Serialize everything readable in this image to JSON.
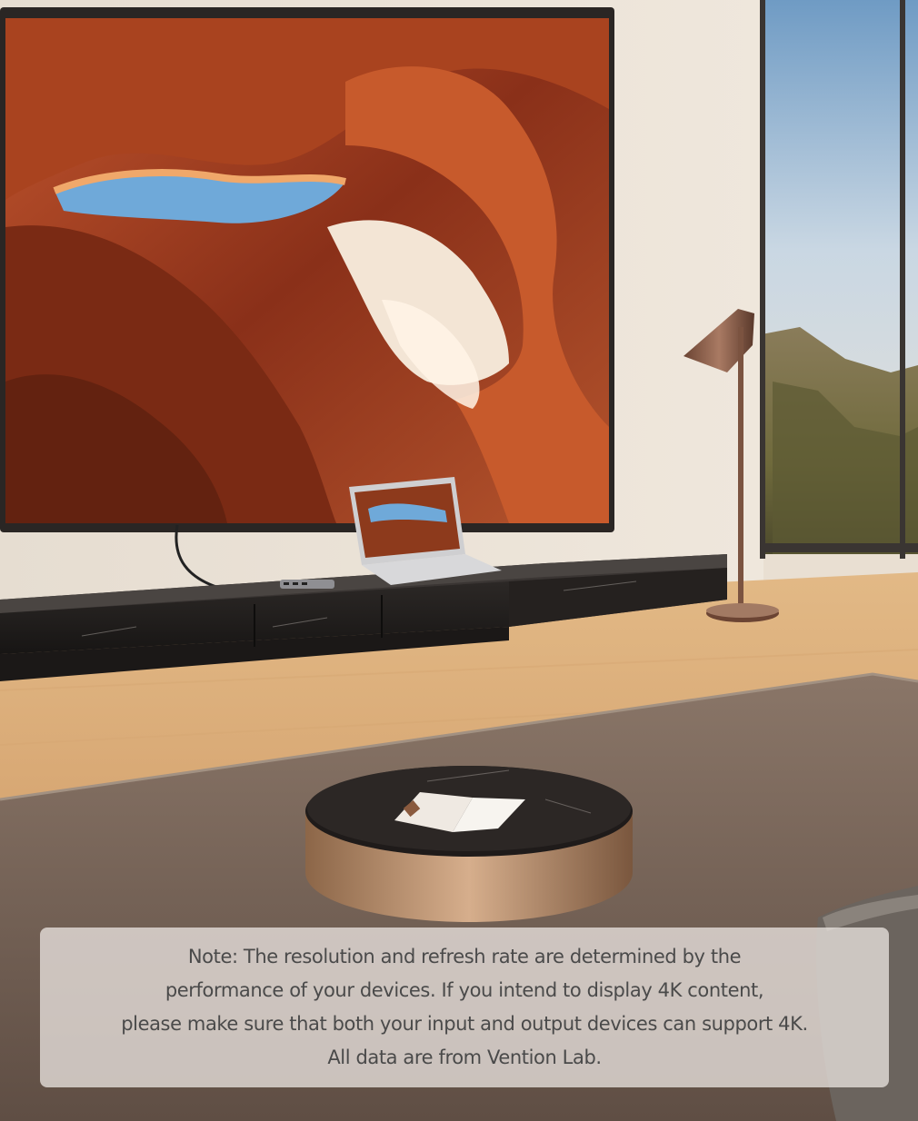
{
  "note": {
    "lines": [
      "Note: The resolution and refresh rate are determined by the",
      "performance of your devices. If you intend to display 4K content,",
      "please make sure that both your input and output devices can support 4K.",
      "All data are from Vention Lab."
    ]
  }
}
